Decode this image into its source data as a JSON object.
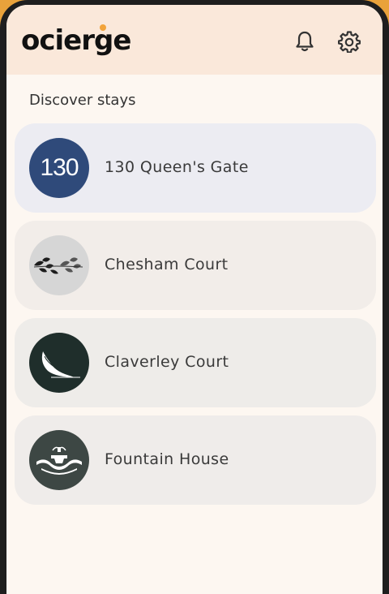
{
  "app": {
    "logo_text": "ocierge"
  },
  "header": {
    "bell_icon": "bell-icon",
    "gear_icon": "gear-icon"
  },
  "section": {
    "title": "Discover stays"
  },
  "stays": [
    {
      "name": "130 Queen's Gate",
      "avatar_text": "130",
      "avatar_color": "#2f4a7a",
      "card_color": "#ececf2"
    },
    {
      "name": "Chesham Court",
      "avatar_icon": "leaves-icon",
      "avatar_color": "#d6d6d6",
      "card_color": "#f2ede9"
    },
    {
      "name": "Claverley Court",
      "avatar_icon": "feather-icon",
      "avatar_color": "#1f2e2b",
      "card_color": "#eeece9"
    },
    {
      "name": "Fountain House",
      "avatar_icon": "fountain-icon",
      "avatar_color": "#3d4744",
      "card_color": "#efecea"
    }
  ],
  "colors": {
    "accent": "#f2a33a",
    "header_bg": "#fae8da",
    "screen_bg": "#fdf7f1"
  }
}
